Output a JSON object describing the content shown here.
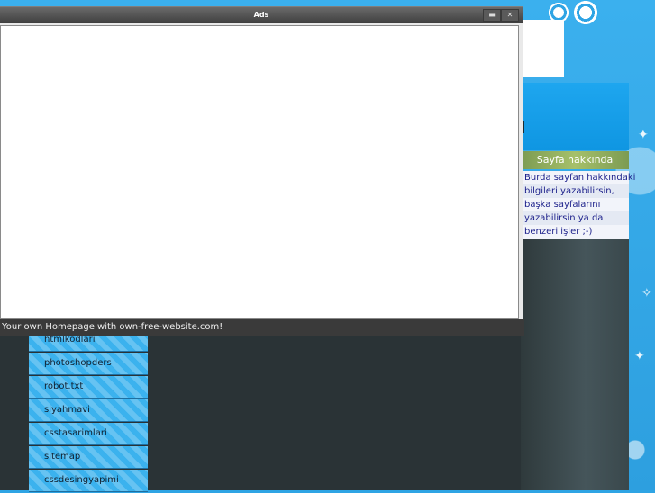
{
  "ads_window": {
    "title": "Ads",
    "footer_text": "Your own Homepage with own-free-website.com!"
  },
  "sidebar": {
    "title": "Sayfa hakkında",
    "text_lines": [
      "Burda sayfan hakkındaki",
      "bilgileri yazabilirsin,",
      "başka sayfalarını",
      "yazabilirsin ya da",
      "benzeri işler ;-)"
    ]
  },
  "nav": {
    "items": [
      "htmlkodlari",
      "photoshopders",
      "robot.txt",
      "siyahmavi",
      "csstasarimlari",
      "sitemap",
      "cssdesingyapimi"
    ]
  },
  "colors": {
    "background": "#2fa4e4",
    "content_dark": "#2a3336",
    "nav_item": "#3bb2ee",
    "sidebar_title": "#8fae5d",
    "sidebar_text": "#1b1f8a"
  },
  "icons": {
    "minimize": "minimize-icon",
    "close": "close-icon"
  }
}
